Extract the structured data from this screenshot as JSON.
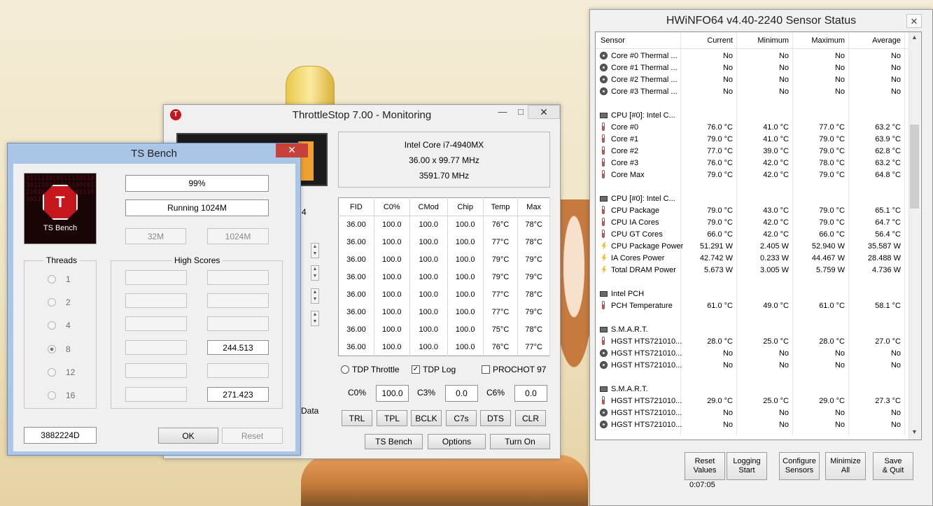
{
  "throttlestop": {
    "title": "ThrottleStop 7.00 - Monitoring",
    "cpu_name": "Intel Core i7-4940MX",
    "multiplier": "36.00 x 99.77 MHz",
    "clock": "3591.70 MHz",
    "partial_left_text": "4",
    "partial_data_text": "Data",
    "table_headers": [
      "FID",
      "C0%",
      "CMod",
      "Chip",
      "Temp",
      "Max"
    ],
    "table_rows": [
      [
        "36.00",
        "100.0",
        "100.0",
        "100.0",
        "76°C",
        "78°C"
      ],
      [
        "36.00",
        "100.0",
        "100.0",
        "100.0",
        "77°C",
        "78°C"
      ],
      [
        "36.00",
        "100.0",
        "100.0",
        "100.0",
        "79°C",
        "79°C"
      ],
      [
        "36.00",
        "100.0",
        "100.0",
        "100.0",
        "79°C",
        "79°C"
      ],
      [
        "36.00",
        "100.0",
        "100.0",
        "100.0",
        "77°C",
        "78°C"
      ],
      [
        "36.00",
        "100.0",
        "100.0",
        "100.0",
        "77°C",
        "79°C"
      ],
      [
        "36.00",
        "100.0",
        "100.0",
        "100.0",
        "75°C",
        "78°C"
      ],
      [
        "36.00",
        "100.0",
        "100.0",
        "100.0",
        "76°C",
        "77°C"
      ]
    ],
    "tdp_throttle": "TDP Throttle",
    "tdp_log": "TDP Log",
    "prochot": "PROCHOT 97",
    "c0_label": "C0%",
    "c0_value": "100.0",
    "c3_label": "C3%",
    "c3_value": "0.0",
    "c6_label": "C6%",
    "c6_value": "0.0",
    "buttons": [
      "TRL",
      "TPL",
      "BCLK",
      "C7s",
      "DTS",
      "CLR"
    ],
    "ts_bench_label": "TS Bench",
    "options_label": "Options",
    "turn_on_label": "Turn On"
  },
  "bench": {
    "title": "TS Bench",
    "logo_label": "TS Bench",
    "logo_bits": "0111110101111101101011101110111001011101011110101011101011101",
    "progress": "99%",
    "status": "Running 1024M",
    "size_small": "32M",
    "size_large": "1024M",
    "threads_title": "Threads",
    "threads": [
      "1",
      "2",
      "4",
      "8",
      "12",
      "16"
    ],
    "high_scores_title": "High Scores",
    "score_8": "244.513",
    "score_16": "271.423",
    "serial": "3882224D",
    "ok_label": "OK",
    "reset_label": "Reset"
  },
  "hwinfo": {
    "title": "HWiNFO64 v4.40-2240 Sensor Status",
    "columns": [
      "Sensor",
      "Current",
      "Minimum",
      "Maximum",
      "Average"
    ],
    "rows": [
      {
        "name": "Core #0 Thermal ...",
        "cur": "No",
        "min": "No",
        "max": "No",
        "avg": "No",
        "icon": "disk-icon"
      },
      {
        "name": "Core #1 Thermal ...",
        "cur": "No",
        "min": "No",
        "max": "No",
        "avg": "No",
        "icon": "disk-icon"
      },
      {
        "name": "Core #2 Thermal ...",
        "cur": "No",
        "min": "No",
        "max": "No",
        "avg": "No",
        "icon": "disk-icon"
      },
      {
        "name": "Core #3 Thermal ...",
        "cur": "No",
        "min": "No",
        "max": "No",
        "avg": "No",
        "icon": "disk-icon"
      },
      {
        "name": "",
        "cur": "",
        "min": "",
        "max": "",
        "avg": "",
        "icon": ""
      },
      {
        "name": "CPU [#0]: Intel C...",
        "cur": "",
        "min": "",
        "max": "",
        "avg": "",
        "icon": "chip-icon"
      },
      {
        "name": "Core #0",
        "cur": "76.0 °C",
        "min": "41.0 °C",
        "max": "77.0 °C",
        "avg": "63.2 °C",
        "icon": "thermometer-icon"
      },
      {
        "name": "Core #1",
        "cur": "79.0 °C",
        "min": "41.0 °C",
        "max": "79.0 °C",
        "avg": "63.9 °C",
        "icon": "thermometer-icon"
      },
      {
        "name": "Core #2",
        "cur": "77.0 °C",
        "min": "39.0 °C",
        "max": "79.0 °C",
        "avg": "62.8 °C",
        "icon": "thermometer-icon"
      },
      {
        "name": "Core #3",
        "cur": "76.0 °C",
        "min": "42.0 °C",
        "max": "78.0 °C",
        "avg": "63.2 °C",
        "icon": "thermometer-icon"
      },
      {
        "name": "Core Max",
        "cur": "79.0 °C",
        "min": "42.0 °C",
        "max": "79.0 °C",
        "avg": "64.8 °C",
        "icon": "thermometer-icon"
      },
      {
        "name": "",
        "cur": "",
        "min": "",
        "max": "",
        "avg": "",
        "icon": ""
      },
      {
        "name": "CPU [#0]: Intel C...",
        "cur": "",
        "min": "",
        "max": "",
        "avg": "",
        "icon": "chip-icon"
      },
      {
        "name": "CPU Package",
        "cur": "79.0 °C",
        "min": "43.0 °C",
        "max": "79.0 °C",
        "avg": "65.1 °C",
        "icon": "thermometer-icon"
      },
      {
        "name": "CPU IA Cores",
        "cur": "79.0 °C",
        "min": "42.0 °C",
        "max": "79.0 °C",
        "avg": "64.7 °C",
        "icon": "thermometer-icon"
      },
      {
        "name": "CPU GT Cores",
        "cur": "66.0 °C",
        "min": "42.0 °C",
        "max": "66.0 °C",
        "avg": "56.4 °C",
        "icon": "thermometer-icon"
      },
      {
        "name": "CPU Package Power",
        "cur": "51.291 W",
        "min": "2.405 W",
        "max": "52.940 W",
        "avg": "35.587 W",
        "icon": "lightning-icon"
      },
      {
        "name": "IA Cores Power",
        "cur": "42.742 W",
        "min": "0.233 W",
        "max": "44.467 W",
        "avg": "28.488 W",
        "icon": "lightning-icon"
      },
      {
        "name": "Total DRAM Power",
        "cur": "5.673 W",
        "min": "3.005 W",
        "max": "5.759 W",
        "avg": "4.736 W",
        "icon": "lightning-icon"
      },
      {
        "name": "",
        "cur": "",
        "min": "",
        "max": "",
        "avg": "",
        "icon": ""
      },
      {
        "name": "Intel PCH",
        "cur": "",
        "min": "",
        "max": "",
        "avg": "",
        "icon": "chip-icon"
      },
      {
        "name": "PCH Temperature",
        "cur": "61.0 °C",
        "min": "49.0 °C",
        "max": "61.0 °C",
        "avg": "58.1 °C",
        "icon": "thermometer-icon"
      },
      {
        "name": "",
        "cur": "",
        "min": "",
        "max": "",
        "avg": "",
        "icon": ""
      },
      {
        "name": "S.M.A.R.T.",
        "cur": "",
        "min": "",
        "max": "",
        "avg": "",
        "icon": "chip-icon"
      },
      {
        "name": "HGST HTS721010...",
        "cur": "28.0 °C",
        "min": "25.0 °C",
        "max": "28.0 °C",
        "avg": "27.0 °C",
        "icon": "thermometer-icon"
      },
      {
        "name": "HGST HTS721010...",
        "cur": "No",
        "min": "No",
        "max": "No",
        "avg": "No",
        "icon": "disk-icon"
      },
      {
        "name": "HGST HTS721010...",
        "cur": "No",
        "min": "No",
        "max": "No",
        "avg": "No",
        "icon": "disk-icon"
      },
      {
        "name": "",
        "cur": "",
        "min": "",
        "max": "",
        "avg": "",
        "icon": ""
      },
      {
        "name": "S.M.A.R.T.",
        "cur": "",
        "min": "",
        "max": "",
        "avg": "",
        "icon": "chip-icon"
      },
      {
        "name": "HGST HTS721010...",
        "cur": "29.0 °C",
        "min": "25.0 °C",
        "max": "29.0 °C",
        "avg": "27.3 °C",
        "icon": "thermometer-icon"
      },
      {
        "name": "HGST HTS721010...",
        "cur": "No",
        "min": "No",
        "max": "No",
        "avg": "No",
        "icon": "disk-icon"
      },
      {
        "name": "HGST HTS721010...",
        "cur": "No",
        "min": "No",
        "max": "No",
        "avg": "No",
        "icon": "disk-icon"
      }
    ],
    "buttons": [
      {
        "line1": "Reset",
        "line2": "Values"
      },
      {
        "line1": "Logging",
        "line2": "Start"
      },
      {
        "line1": "Configure",
        "line2": "Sensors"
      },
      {
        "line1": "Minimize",
        "line2": "All"
      },
      {
        "line1": "Save",
        "line2": "& Quit"
      }
    ],
    "timer": "0:07:05"
  }
}
